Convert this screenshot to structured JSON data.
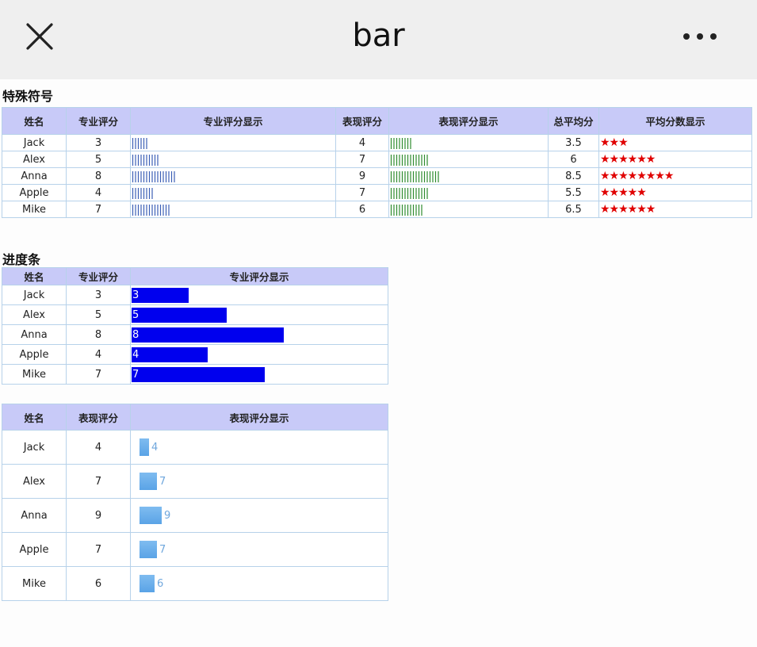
{
  "window": {
    "title": "bar"
  },
  "colors": {
    "tick_blue": "#3b5fb5",
    "tick_green": "#2e8b2e",
    "star_red": "#e00000",
    "progress_blue": "#0000ee",
    "soft_blue": "#6fb0ec",
    "header_bg": "#c8caf8"
  },
  "section1": {
    "title": "特殊符号",
    "headers": [
      "姓名",
      "专业评分",
      "专业评分显示",
      "表现评分",
      "表现评分显示",
      "总平均分",
      "平均分数显示"
    ],
    "rows": [
      {
        "name": "Jack",
        "pro": "3",
        "perf": "4",
        "avg": "3.5",
        "pro_ticks": 6,
        "perf_ticks": 8,
        "stars": "★★★"
      },
      {
        "name": "Alex",
        "pro": "5",
        "perf": "7",
        "avg": "6",
        "pro_ticks": 10,
        "perf_ticks": 14,
        "stars": "★★★★★★"
      },
      {
        "name": "Anna",
        "pro": "8",
        "perf": "9",
        "avg": "8.5",
        "pro_ticks": 16,
        "perf_ticks": 18,
        "stars": "★★★★★★★★"
      },
      {
        "name": "Apple",
        "pro": "4",
        "perf": "7",
        "avg": "5.5",
        "pro_ticks": 8,
        "perf_ticks": 14,
        "stars": "★★★★★"
      },
      {
        "name": "Mike",
        "pro": "7",
        "perf": "6",
        "avg": "6.5",
        "pro_ticks": 14,
        "perf_ticks": 12,
        "stars": "★★★★★★"
      }
    ]
  },
  "section2": {
    "title": "进度条",
    "headers": [
      "姓名",
      "专业评分",
      "专业评分显示"
    ],
    "max": 10,
    "rows": [
      {
        "name": "Jack",
        "value": "3"
      },
      {
        "name": "Alex",
        "value": "5"
      },
      {
        "name": "Anna",
        "value": "8"
      },
      {
        "name": "Apple",
        "value": "4"
      },
      {
        "name": "Mike",
        "value": "7"
      }
    ]
  },
  "section3": {
    "headers": [
      "姓名",
      "表现评分",
      "表现评分显示"
    ],
    "max": 10,
    "rows": [
      {
        "name": "Jack",
        "value": "4"
      },
      {
        "name": "Alex",
        "value": "7"
      },
      {
        "name": "Anna",
        "value": "9"
      },
      {
        "name": "Apple",
        "value": "7"
      },
      {
        "name": "Mike",
        "value": "6"
      }
    ]
  }
}
